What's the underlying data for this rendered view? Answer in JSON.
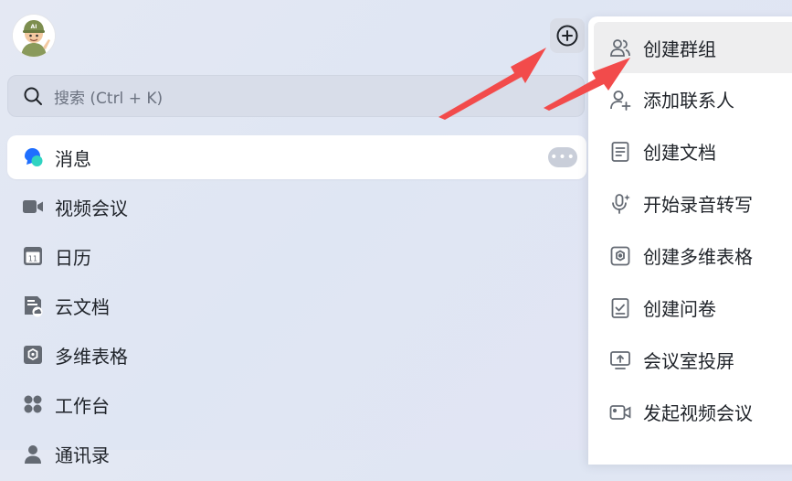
{
  "avatar": {
    "badge_text": "AI"
  },
  "search": {
    "placeholder": "搜索 (Ctrl + K)"
  },
  "nav": {
    "items": [
      {
        "label": "消息",
        "icon": "chat-bubble-icon",
        "active": true
      },
      {
        "label": "视频会议",
        "icon": "video-camera-icon"
      },
      {
        "label": "日历",
        "icon": "calendar-icon",
        "day": "11"
      },
      {
        "label": "云文档",
        "icon": "cloud-doc-icon"
      },
      {
        "label": "多维表格",
        "icon": "multidim-table-icon"
      },
      {
        "label": "工作台",
        "icon": "workspace-grid-icon"
      },
      {
        "label": "通讯录",
        "icon": "contacts-icon"
      }
    ],
    "more_badge": "•••"
  },
  "menu": {
    "items": [
      {
        "label": "创建群组",
        "icon": "create-group-icon"
      },
      {
        "label": "添加联系人",
        "icon": "add-contact-icon"
      },
      {
        "label": "创建文档",
        "icon": "document-icon"
      },
      {
        "label": "开始录音转写",
        "icon": "microphone-icon"
      },
      {
        "label": "创建多维表格",
        "icon": "multidim-table-icon"
      },
      {
        "label": "创建问卷",
        "icon": "survey-checkbox-icon"
      },
      {
        "label": "会议室投屏",
        "icon": "screen-cast-icon"
      },
      {
        "label": "发起视频会议",
        "icon": "video-meeting-icon"
      }
    ]
  },
  "colors": {
    "accent_blue": "#1f6fff",
    "accent_teal": "#2fd3c1",
    "arrow_red": "#f24b4b",
    "icon_gray": "#646a73"
  }
}
